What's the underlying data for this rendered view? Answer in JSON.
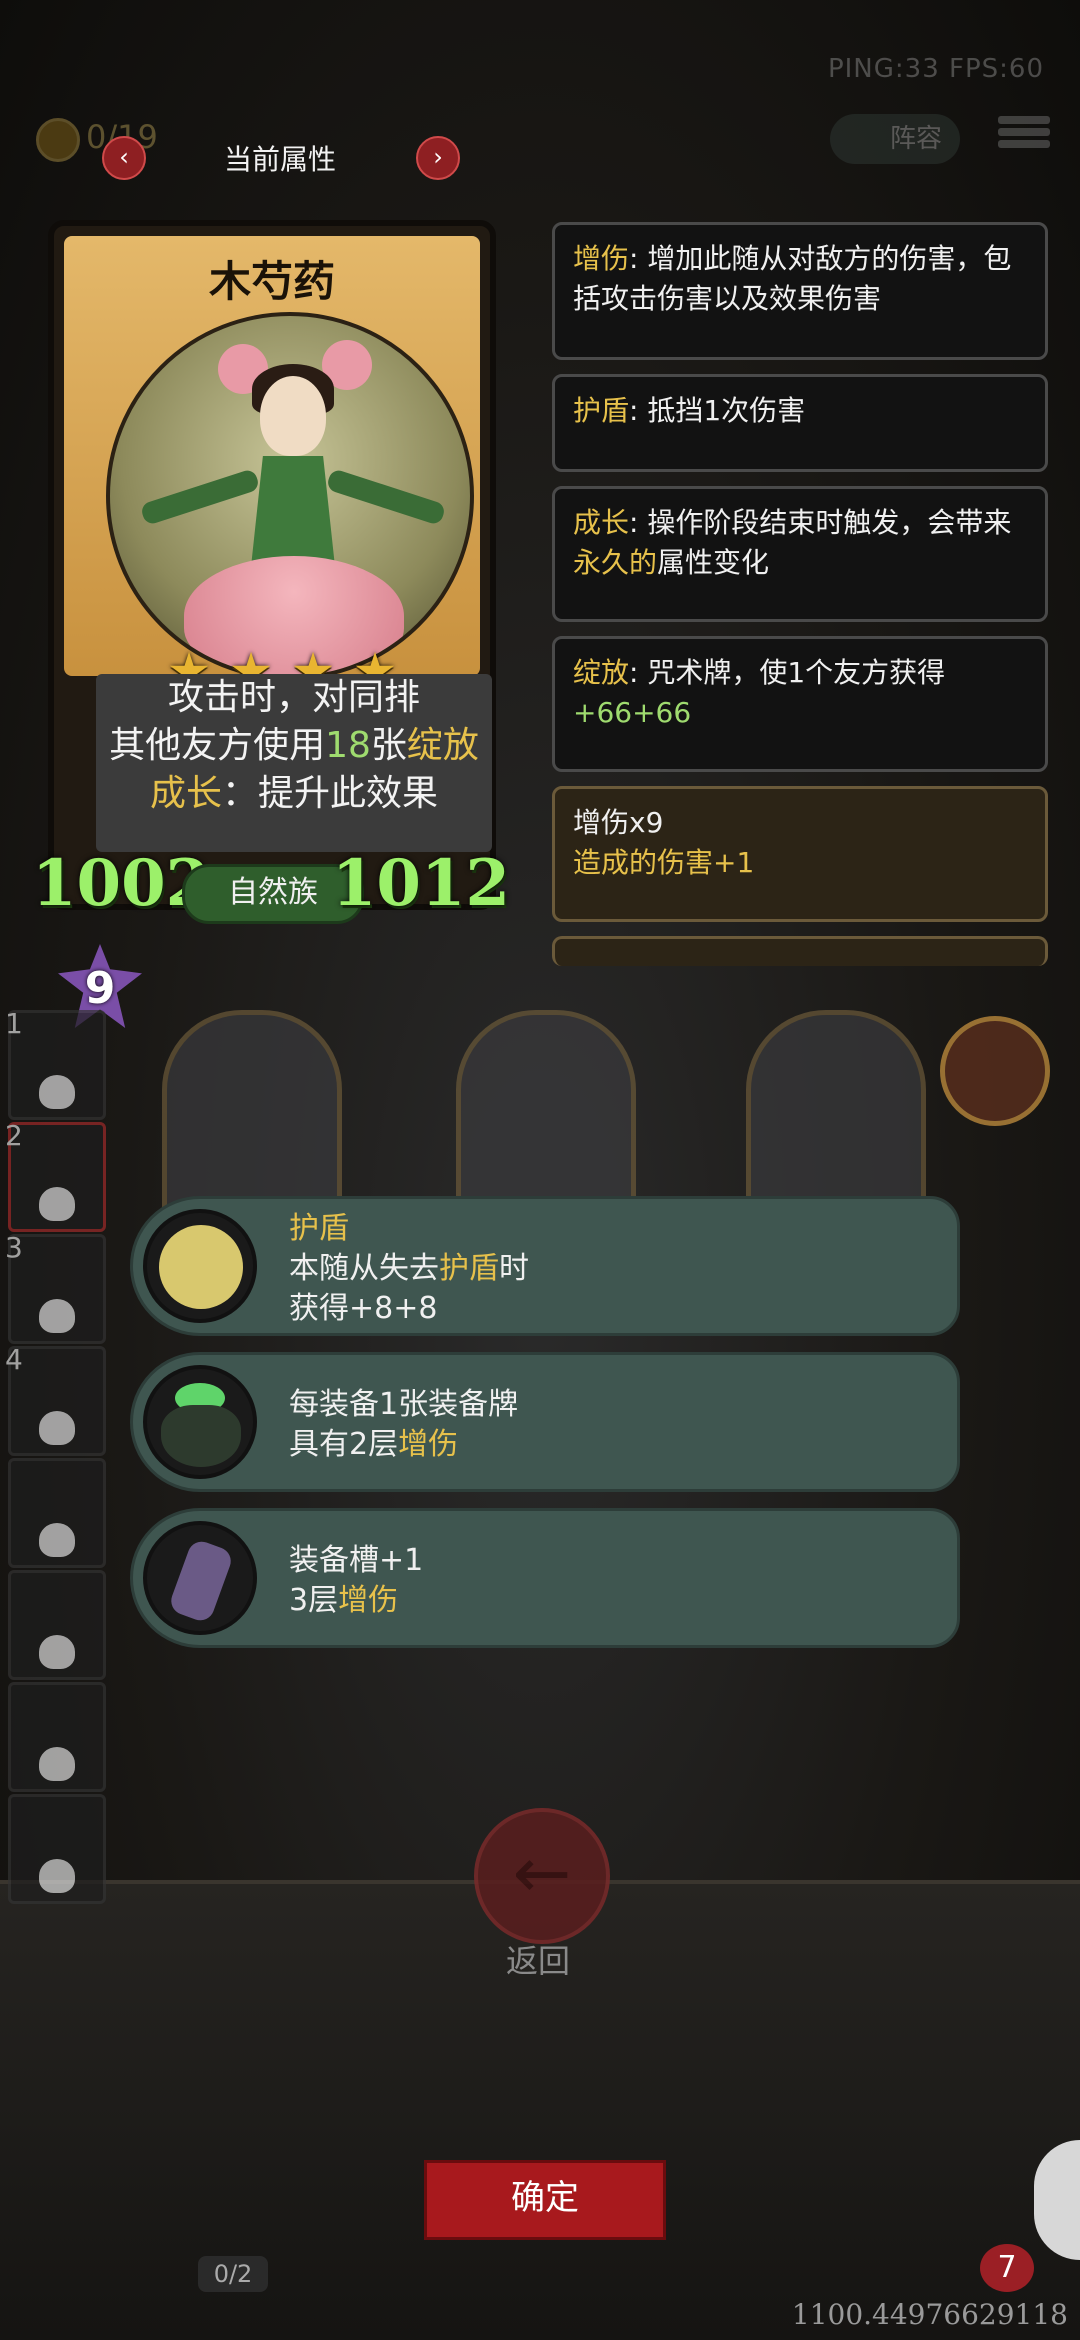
{
  "hud": {
    "ping": "PING:33   FPS:60",
    "coins": "0/19",
    "lineup_label": "阵容"
  },
  "attr_panel": {
    "title": "当前属性",
    "prev_symbol": "‹",
    "next_symbol": "›"
  },
  "card": {
    "name": "木芍药",
    "stars": 4,
    "star_symbol": "★",
    "desc_line1": "攻击时，对同排",
    "desc_line2_pre": "其他友方使用",
    "desc_line2_num": "18",
    "desc_line2_mid": "张",
    "desc_line2_kw": "绽放",
    "desc_line3_kw": "成长",
    "desc_line3_rest": "：提升此效果",
    "attack": "1002",
    "health": "1012",
    "tribe": "自然族",
    "level": "9"
  },
  "keywords": [
    {
      "kw": "增伤",
      "text": ": 增加此随从对敌方的伤害，包括攻击伤害以及效果伤害"
    },
    {
      "kw": "护盾",
      "text": ": 抵挡1次伤害"
    },
    {
      "kw": "成长",
      "text_pre": ": 操作阶段结束时触发，会带来",
      "text_hl": "永久的",
      "text_post": "属性变化"
    },
    {
      "kw": "绽放",
      "text": ": 咒术牌，使1个友方获得",
      "value": "+66+66"
    }
  ],
  "buff": {
    "title": "增伤x9",
    "text": "造成的伤害+1"
  },
  "side_slots": [
    "1",
    "2",
    "3",
    "4"
  ],
  "effects": [
    {
      "title": "护盾",
      "line1_pre": "本随从失去",
      "line1_kw": "护盾",
      "line1_post": "时",
      "line2": "获得+8+8"
    },
    {
      "line1": "每装备1张装备牌",
      "line2_pre": "具有2层",
      "line2_kw": "增伤"
    },
    {
      "line1": "装备槽+1",
      "line2_pre": "3层",
      "line2_kw": "增伤"
    }
  ],
  "bottom": {
    "back_label": "返回",
    "confirm_label": "确定",
    "slot_count": "0/2",
    "hero_hp": "7",
    "coords": "1100.44976629118"
  },
  "colors": {
    "gold_keyword": "#e7c14b",
    "green_value": "#9fdb6f",
    "confirm_red": "#a8191d",
    "row_green": "#3f5650"
  }
}
